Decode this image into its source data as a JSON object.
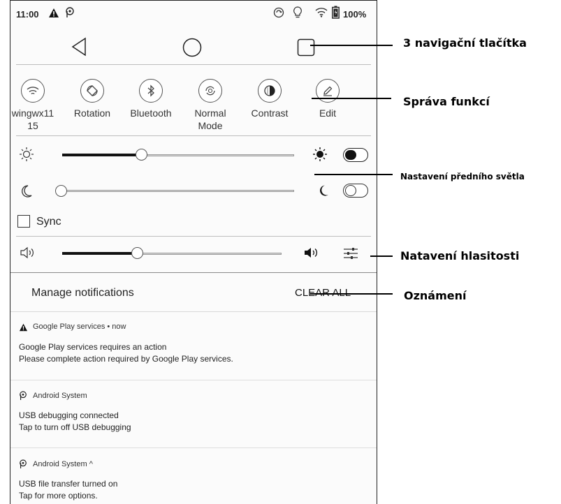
{
  "status_bar": {
    "time": "11:00",
    "battery": "100%"
  },
  "quick_settings": [
    {
      "label": "wingwx11\n15",
      "icon": "wifi-icon"
    },
    {
      "label": "Rotation",
      "icon": "rotation-icon"
    },
    {
      "label": "Bluetooth",
      "icon": "bluetooth-icon"
    },
    {
      "label": "Normal\nMode",
      "icon": "refresh-mode-icon"
    },
    {
      "label": "Contrast",
      "icon": "contrast-icon"
    },
    {
      "label": "Edit",
      "icon": "pencil-icon"
    }
  ],
  "brightness": {
    "warm_level": 0.34,
    "cold_level": 0.0,
    "warm_toggle": "on",
    "cold_toggle": "off"
  },
  "sync": {
    "label": "Sync",
    "checked": false
  },
  "volume": {
    "level": 0.34
  },
  "notifications_header": {
    "manage_label": "Manage notifications",
    "clear_label": "CLEAR ALL"
  },
  "notifications": [
    {
      "app": "Google Play services • now",
      "line1": "Google Play services requires an action",
      "line2": "Please complete action required by Google Play services."
    },
    {
      "app": "Android System",
      "line1": "USB debugging connected",
      "line2": "Tap to turn off USB debugging"
    },
    {
      "app": "Android System ^",
      "line1": "USB file transfer turned on",
      "line2": "Tap for more options."
    }
  ],
  "callouts": {
    "nav": "3 navigační tlačítka",
    "functions": "Správa funkcí",
    "frontlight": "Nastavení předního světla",
    "volume": "Natavení hlasitosti",
    "notifications": "Oznámení"
  },
  "colors": {
    "ink": "#111111",
    "divider": "#cfcfcf",
    "panel": "#fbfbfb"
  }
}
